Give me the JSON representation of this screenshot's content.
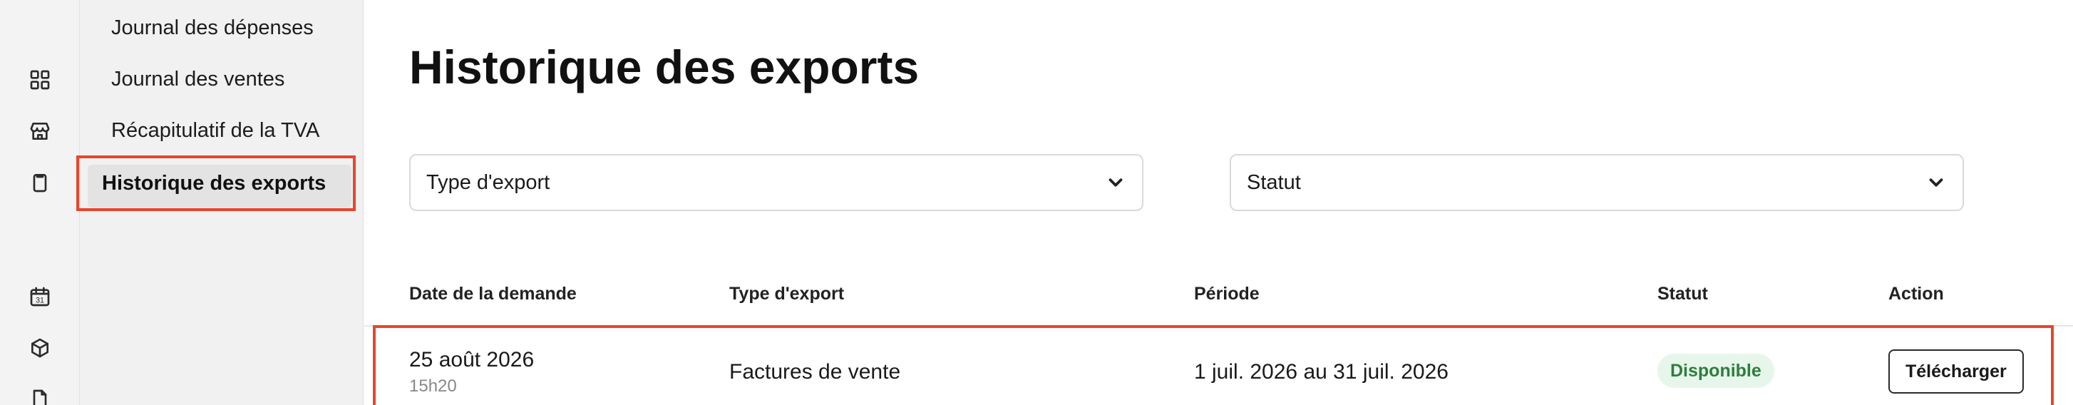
{
  "rail": {
    "icons": [
      "dashboard-grid-icon",
      "store-icon",
      "clipboard-icon",
      "calendar-icon",
      "box-icon",
      "document-icon"
    ],
    "calendar_day": "31"
  },
  "subnav": {
    "items": [
      {
        "label": "Journal des dépenses"
      },
      {
        "label": "Journal des ventes"
      },
      {
        "label": "Récapitulatif de la TVA"
      },
      {
        "label": "Historique des exports"
      }
    ],
    "active_index": 3
  },
  "main": {
    "title": "Historique des exports",
    "filters": [
      {
        "label": "Type d'export",
        "icon": "chevron-down-icon"
      },
      {
        "label": "Statut",
        "icon": "chevron-down-icon"
      }
    ],
    "table": {
      "columns": [
        "Date de la demande",
        "Type d'export",
        "Période",
        "Statut",
        "Action"
      ],
      "rows": [
        {
          "date": "25 août 2026",
          "time": "15h20",
          "type": "Factures de vente",
          "period": "1 juil. 2026 au 31 juil. 2026",
          "status": "Disponible",
          "action": "Télécharger"
        }
      ]
    }
  },
  "colors": {
    "highlight": "#e8452c",
    "status_bg": "#e7f6ea",
    "status_text": "#2e7d3e"
  }
}
